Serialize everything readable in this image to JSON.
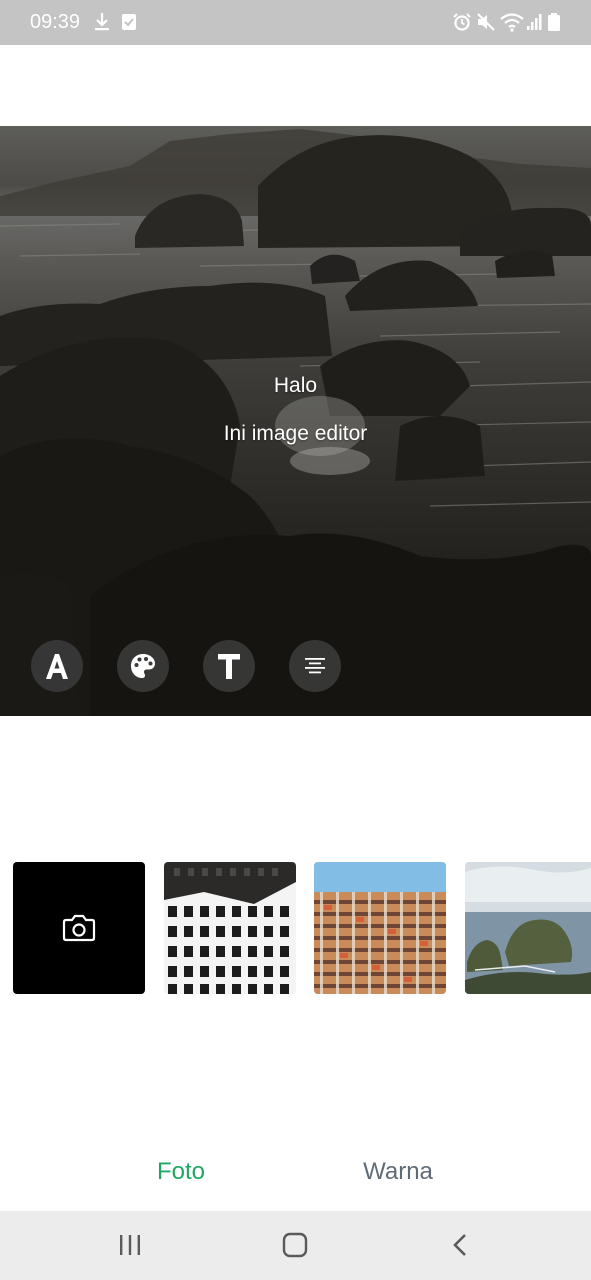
{
  "status_bar": {
    "time": "09:39",
    "left_icons": [
      "download-icon",
      "checklist-icon"
    ],
    "right_icons": [
      "alarm-icon",
      "mute-icon",
      "wifi-icon",
      "signal-icon",
      "battery-icon"
    ]
  },
  "editor": {
    "text_line_1": "Halo",
    "text_line_2": "Ini image editor",
    "tools": [
      {
        "name": "font-style",
        "icon": "font-a-icon"
      },
      {
        "name": "color",
        "icon": "palette-icon"
      },
      {
        "name": "text-style",
        "icon": "text-t-icon"
      },
      {
        "name": "align",
        "icon": "align-center-icon"
      }
    ]
  },
  "thumbnails": [
    {
      "name": "camera",
      "icon": "camera-icon"
    },
    {
      "name": "building-black-white"
    },
    {
      "name": "building-colorful"
    },
    {
      "name": "sea-rocks"
    }
  ],
  "tabs": {
    "photo": "Foto",
    "color": "Warna",
    "active": "photo",
    "active_color": "#1fa862",
    "inactive_color": "#5f6b77"
  },
  "nav_bar": {
    "icons": [
      "recent-apps-icon",
      "home-icon",
      "back-icon"
    ]
  }
}
